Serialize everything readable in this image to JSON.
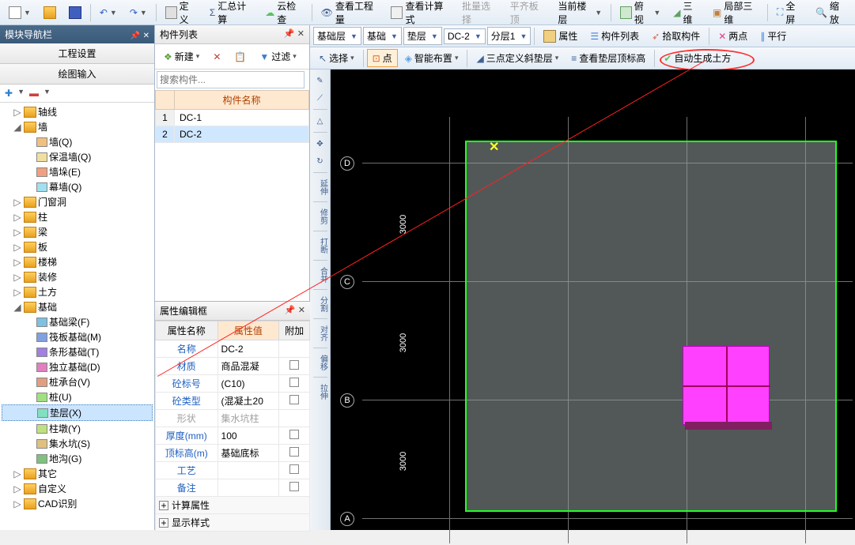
{
  "top_toolbar": {
    "define": "定义",
    "sum_calc": "汇总计算",
    "cloud_check": "云检查",
    "view_eng": "查看工程量",
    "view_calc": "查看计算式",
    "batch_select": "批量选择",
    "level_top": "平齐板顶",
    "current_floor": "当前楼层",
    "top_view": "俯视",
    "three_d": "三维",
    "local_3d": "局部三维",
    "full_screen": "全屏",
    "zoom": "缩放"
  },
  "nav": {
    "title": "模块导航栏",
    "tab1": "工程设置",
    "tab2": "绘图输入",
    "nodes": {
      "axis": "轴线",
      "wall": "墙",
      "wall_q": "墙(Q)",
      "insul_wall": "保温墙(Q)",
      "wall_duo": "墙垛(E)",
      "curtain_wall": "幕墙(Q)",
      "door_window": "门窗洞",
      "column": "柱",
      "beam": "梁",
      "slab": "板",
      "stair": "楼梯",
      "decor": "装修",
      "earth": "土方",
      "foundation": "基础",
      "found_beam": "基础梁(F)",
      "raft": "筏板基础(M)",
      "strip": "条形基础(T)",
      "isolated": "独立基础(D)",
      "cap": "桩承台(V)",
      "pile": "桩(U)",
      "bedding": "垫层(X)",
      "pier": "柱墩(Y)",
      "sump": "集水坑(S)",
      "trench": "地沟(G)",
      "other": "其它",
      "custom": "自定义",
      "cad": "CAD识别"
    }
  },
  "comp_list": {
    "title": "构件列表",
    "new_btn": "新建",
    "filter": "过滤",
    "search_ph": "搜索构件...",
    "header": "构件名称",
    "rows": [
      {
        "n": "1",
        "name": "DC-1"
      },
      {
        "n": "2",
        "name": "DC-2"
      }
    ]
  },
  "props": {
    "title": "属性编辑框",
    "col_name": "属性名称",
    "col_val": "属性值",
    "col_add": "附加",
    "rows": {
      "name_l": "名称",
      "name_v": "DC-2",
      "mat_l": "材质",
      "mat_v": "商品混凝",
      "grade_l": "砼标号",
      "grade_v": "(C10)",
      "type_l": "砼类型",
      "type_v": "(混凝土20",
      "shape_l": "形状",
      "shape_v": "集水坑柱",
      "thick_l": "厚度(mm)",
      "thick_v": "100",
      "elev_l": "顶标高(m)",
      "elev_v": "基础底标",
      "craft_l": "工艺",
      "note_l": "备注",
      "calc_l": "计算属性",
      "disp_l": "显示样式"
    }
  },
  "sec1": {
    "floor": "基础层",
    "cat": "基础",
    "sub": "垫层",
    "item": "DC-2",
    "layer": "分层1",
    "attr": "属性",
    "complist": "构件列表",
    "pick": "拾取构件",
    "two_pt": "两点",
    "parallel": "平行"
  },
  "sec2": {
    "select": "选择",
    "point": "点",
    "smart": "智能布置",
    "three_pt": "三点定义斜垫层",
    "view_elev": "查看垫层顶标高",
    "auto_earth": "自动生成土方"
  },
  "side_tools": {
    "extend": "延伸",
    "trim": "修剪",
    "break": "打断",
    "merge": "合并",
    "split": "分割",
    "align": "对齐",
    "offset": "偏移",
    "stretch": "拉伸"
  },
  "axes": {
    "a": "A",
    "b": "B",
    "c": "C",
    "d": "D",
    "d1": "3000",
    "d2": "3000",
    "d3": "3000"
  }
}
